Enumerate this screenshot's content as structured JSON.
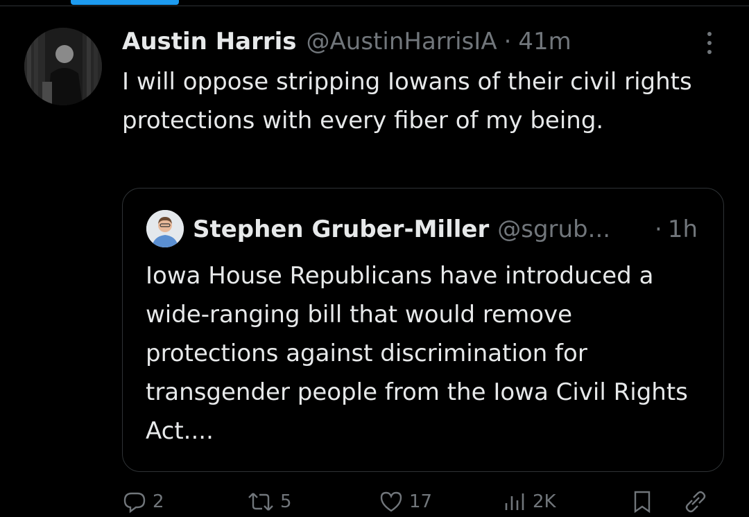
{
  "tweet": {
    "author_name": "Austin Harris",
    "author_handle": "@AustinHarrisIA",
    "separator": "·",
    "time": "41m",
    "text": "I will oppose stripping Iowans of their civil rights protections with every fiber of my being."
  },
  "quote": {
    "author_name": "Stephen Gruber-Miller",
    "author_handle": "@sgrub...",
    "separator": "·",
    "time": "1h",
    "text": "Iowa House Republicans have introduced a wide-ranging bill that would remove protections against discrimination for transgender people from the Iowa Civil Rights Act...."
  },
  "actions": {
    "replies": "2",
    "reposts": "5",
    "likes": "17",
    "views": "2K"
  },
  "icons": {
    "more": "more-vertical-icon",
    "reply": "reply-icon",
    "repost": "repost-icon",
    "like": "heart-icon",
    "views": "views-icon",
    "bookmark": "bookmark-icon",
    "share": "share-icon"
  },
  "colors": {
    "background": "#000000",
    "text": "#e7e9ea",
    "secondary": "#71767b",
    "border": "#2f3336",
    "accent": "#1d9bf0"
  }
}
